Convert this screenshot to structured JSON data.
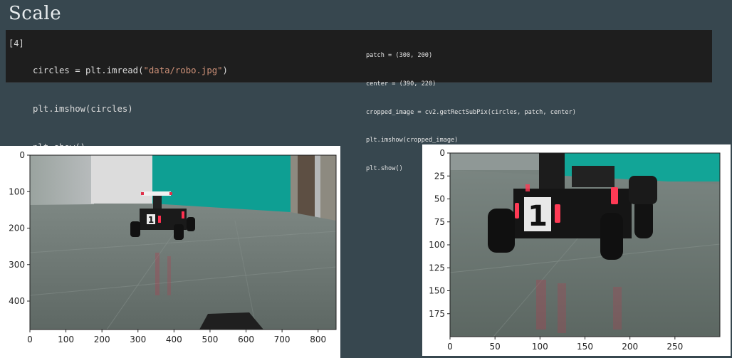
{
  "slide": {
    "title": "Scale"
  },
  "cell": {
    "prompt": "[4]",
    "lines": [
      {
        "pre": "circles = plt.imread(",
        "str": "\"data/robo.jpg\"",
        "post": ")"
      },
      {
        "pre": "plt.imshow(circles)",
        "str": "",
        "post": ""
      },
      {
        "pre": "plt.show()",
        "str": "",
        "post": ""
      }
    ],
    "side_lines": [
      "patch = (300, 200)",
      "center = (390, 220)",
      "cropped_image = cv2.getRectSubPix(circles, patch, center)",
      "plt.imshow(cropped_image)",
      "plt.show()"
    ]
  },
  "plot_full": {
    "x_ticks": [
      "0",
      "100",
      "200",
      "300",
      "400",
      "500",
      "600",
      "700",
      "800"
    ],
    "y_ticks": [
      "0",
      "100",
      "200",
      "300",
      "400"
    ],
    "xlim": [
      0,
      850
    ],
    "ylim": [
      0,
      478
    ],
    "robot_number": "1"
  },
  "plot_crop": {
    "x_ticks": [
      "0",
      "50",
      "100",
      "150",
      "200",
      "250"
    ],
    "y_ticks": [
      "0",
      "25",
      "50",
      "75",
      "100",
      "125",
      "150",
      "175"
    ],
    "xlim": [
      0,
      300
    ],
    "ylim": [
      0,
      200
    ],
    "robot_number": "1"
  },
  "colors": {
    "background": "#37474f",
    "cell": "#1e1e1e",
    "string": "#ce9178",
    "wall": "#0e9f93",
    "floor": "#6f7a74"
  }
}
